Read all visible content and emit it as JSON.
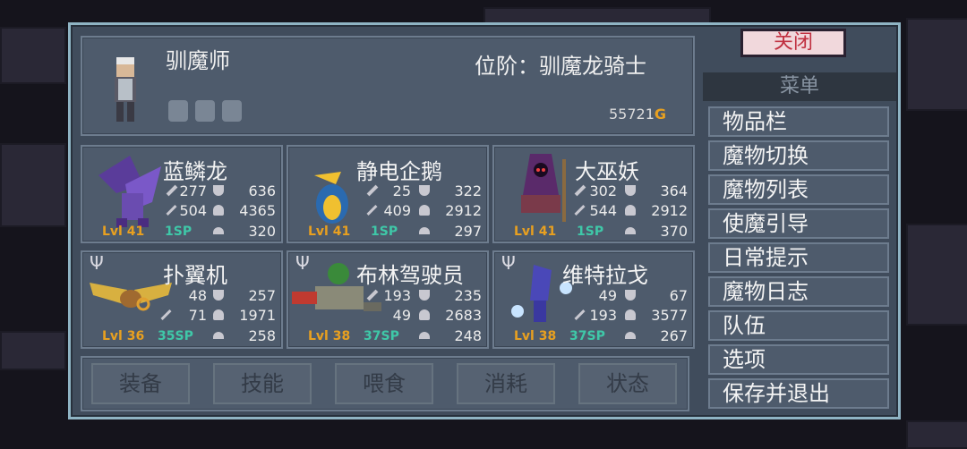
{
  "trainer": {
    "title": "驯魔师",
    "rank_label": "位阶：驯魔龙骑士",
    "gold": "55721",
    "gold_unit": "G"
  },
  "monsters": [
    {
      "name": "蓝鳞龙",
      "atk": "277",
      "def": "636",
      "mag": "504",
      "hp": "4365",
      "lvl": "Lvl 41",
      "sp": "1SP",
      "food": "320"
    },
    {
      "name": "静电企鹅",
      "atk": "25",
      "def": "322",
      "mag": "409",
      "hp": "2912",
      "lvl": "Lvl 41",
      "sp": "1SP",
      "food": "297"
    },
    {
      "name": "大巫妖",
      "atk": "302",
      "def": "364",
      "mag": "544",
      "hp": "2912",
      "lvl": "Lvl 41",
      "sp": "1SP",
      "food": "370"
    },
    {
      "name": "扑翼机",
      "atk": "48",
      "def": "257",
      "mag": "71",
      "hp": "1971",
      "lvl": "Lvl 36",
      "sp": "35SP",
      "food": "258"
    },
    {
      "name": "布林驾驶员",
      "atk": "193",
      "def": "235",
      "mag": "49",
      "hp": "2683",
      "lvl": "Lvl 38",
      "sp": "37SP",
      "food": "248"
    },
    {
      "name": "维特拉戈",
      "atk": "49",
      "def": "67",
      "mag": "193",
      "hp": "3577",
      "lvl": "Lvl 38",
      "sp": "37SP",
      "food": "267"
    }
  ],
  "actions": [
    "装备",
    "技能",
    "喂食",
    "消耗",
    "状态"
  ],
  "sidebar": {
    "close_label": "关闭",
    "menu_title": "菜单",
    "items": [
      "物品栏",
      "魔物切换",
      "魔物列表",
      "使魔引导",
      "日常提示",
      "魔物日志",
      "队伍",
      "选项",
      "保存并退出"
    ]
  },
  "colors": {
    "frame_border": "#8fb4c4",
    "panel_bg": "#4e5b6c",
    "level": "#e8a020",
    "sp": "#3fc8a8",
    "close_text": "#c03040"
  }
}
